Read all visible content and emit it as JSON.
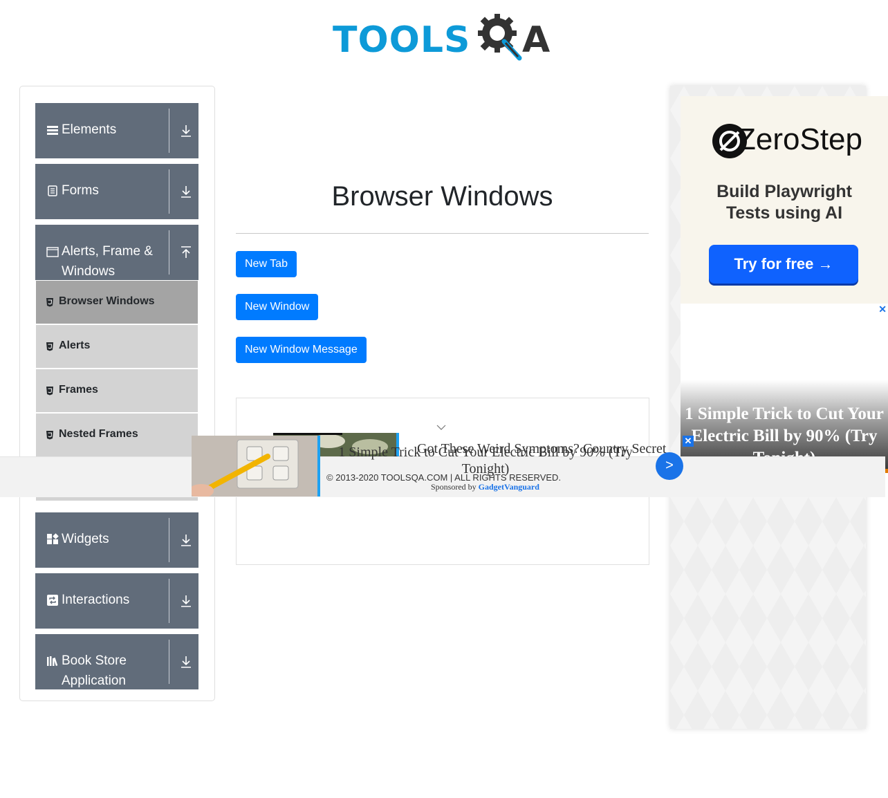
{
  "logo": {
    "main": "TOOLS",
    "tail": "A"
  },
  "sidebar": {
    "groups": [
      {
        "label": "Elements",
        "icon": "hamburger-icon",
        "arrow": "download-arrow-icon"
      },
      {
        "label": "Forms",
        "icon": "document-icon",
        "arrow": "download-arrow-icon"
      },
      {
        "label": "Alerts, Frame & Windows",
        "icon": "window-icon",
        "arrow": "upload-arrow-icon"
      },
      {
        "label": "Widgets",
        "icon": "widgets-icon",
        "arrow": "download-arrow-icon"
      },
      {
        "label": "Interactions",
        "icon": "repeat-icon",
        "arrow": "download-arrow-icon"
      },
      {
        "label": "Book Store Application",
        "icon": "books-icon",
        "arrow": "download-arrow-icon"
      }
    ],
    "sub_items": [
      {
        "label": "Browser Windows",
        "active": true
      },
      {
        "label": "Alerts",
        "active": false
      },
      {
        "label": "Frames",
        "active": false
      },
      {
        "label": "Nested Frames",
        "active": false
      }
    ]
  },
  "main": {
    "title": "Browser Windows",
    "buttons": {
      "new_tab": "New Tab",
      "new_window": "New Window",
      "new_window_message": "New Window Message"
    }
  },
  "footer": {
    "copyright": "© 2013-2020 TOOLSQA.COM | ALL RIGHTS RESERVED."
  },
  "ads": {
    "zerostep": {
      "brand": "ZeroStep",
      "line1": "Build Playwright",
      "line2": "Tests using AI",
      "cta": "Try for free →"
    },
    "side_headline": "1 Simple Trick to Cut Your Electric Bill by 90% (Try Tonight)",
    "overlay_headline": "1 Simple Trick to Cut Your Electric Bill by 90% (Try Tonight)",
    "overlay_headline2": "Got These Weird Symptoms? Country Secret",
    "sponsored_prefix": "Sponsored by",
    "sponsor": "GadgetVanguard",
    "go_label": ">",
    "close_label": "✕"
  },
  "colors": {
    "brand_blue": "#0d9ad8",
    "button_blue": "#007bff",
    "sidebar_group": "#616c7a",
    "sub_item": "#d3d3d3",
    "sub_item_active": "#a4a4a4"
  }
}
